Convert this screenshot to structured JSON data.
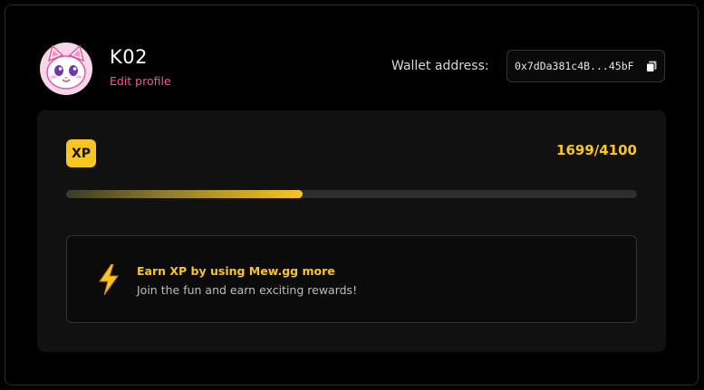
{
  "profile": {
    "username": "K02",
    "edit_label": "Edit profile",
    "avatar_icon": "cat-avatar-icon"
  },
  "wallet": {
    "label": "Wallet address:",
    "address": "0x7dDa381c4B...45bF",
    "copy_icon": "copy-icon"
  },
  "xp": {
    "badge_label": "XP",
    "progress_text": "1699/4100",
    "current": 1699,
    "max": 4100
  },
  "info": {
    "icon": "lightning-bolt-icon",
    "title": "Earn XP by using Mew.gg more",
    "subtitle": "Join the fun and earn exciting rewards!"
  },
  "colors": {
    "accent_yellow": "#f9c521",
    "accent_pink": "#ff4fa3",
    "background": "#000000",
    "panel": "#111111"
  }
}
